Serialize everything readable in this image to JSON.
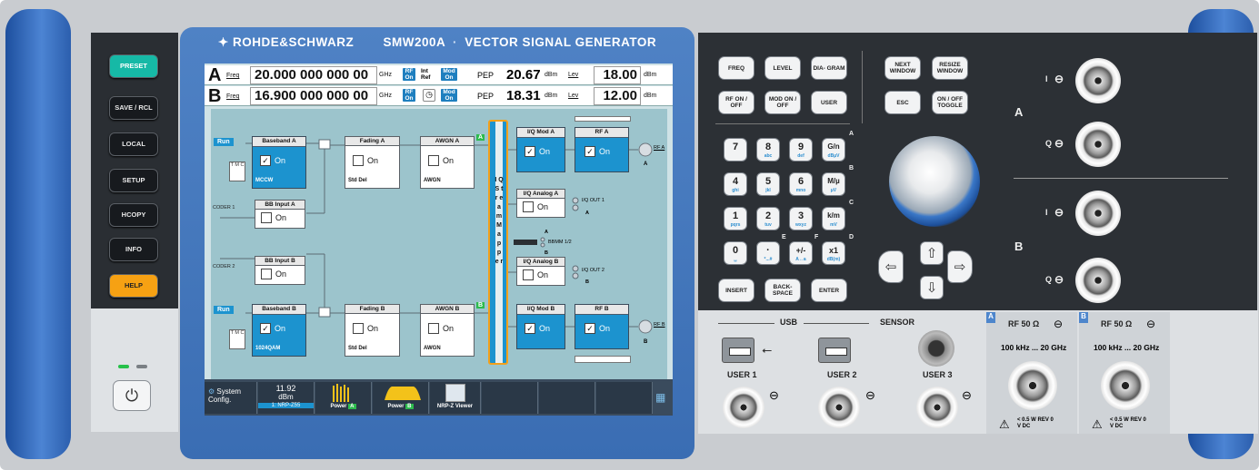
{
  "brand": {
    "logo": "ROHDE&SCHWARZ",
    "model": "SMW200A",
    "product": "VECTOR SIGNAL GENERATOR"
  },
  "colors": {
    "handle": "#2f63b0",
    "accent_blue": "#1c93cf",
    "preset": "#16b9a6",
    "help": "#f6a113",
    "mapper_border": "#f3a01a"
  },
  "hardkeys_left": [
    "PRESET",
    "SAVE / RCL",
    "LOCAL",
    "SETUP",
    "HCOPY",
    "INFO",
    "HELP"
  ],
  "power_icon": "power-icon",
  "status": {
    "a": {
      "letter": "A",
      "freq_label": "Freq",
      "freq_value": "20.000 000 000 00",
      "freq_unit": "GHz",
      "rf": "RF On",
      "int_ref": "Int Ref",
      "mod": "Mod On",
      "pep_label": "PEP",
      "pep_value": "20.67",
      "pep_unit": "dBm",
      "lev_label": "Lev",
      "lev_value": "18.00",
      "lev_unit": "dBm"
    },
    "b": {
      "letter": "B",
      "freq_label": "Freq",
      "freq_value": "16.900 000 000 00",
      "freq_unit": "GHz",
      "rf": "RF On",
      "mod": "Mod On",
      "pep_label": "PEP",
      "pep_value": "18.31",
      "pep_unit": "dBm",
      "lev_label": "Lev",
      "lev_value": "12.00",
      "lev_unit": "dBm"
    }
  },
  "diagram": {
    "run_label": "Run",
    "t_m_c": "T M C",
    "on": "On",
    "baseband_a": {
      "title": "Baseband A",
      "sub": "MCCW"
    },
    "baseband_b": {
      "title": "Baseband B",
      "sub": "1024QAM"
    },
    "coder1": "CODER 1",
    "coder2": "CODER 2",
    "bb_input_a": "BB Input A",
    "bb_input_b": "BB Input B",
    "fading_a": {
      "title": "Fading A",
      "sub": "Std Del"
    },
    "fading_b": {
      "title": "Fading B",
      "sub": "Std Del"
    },
    "awgn_a": {
      "title": "AWGN A",
      "sub": "AWGN"
    },
    "awgn_b": {
      "title": "AWGN B",
      "sub": "AWGN"
    },
    "badge_a": "A",
    "badge_b": "B",
    "mapper": "I Q S t r e a m M a p p e r",
    "iq_mod_a": "I/Q Mod A",
    "iq_mod_b": "I/Q Mod B",
    "rf_a": "RF A",
    "rf_b": "RF B",
    "rf_a_out": "RF A",
    "rf_b_out": "RF B",
    "iq_analog_a": "I/Q Analog A",
    "iq_analog_b": "I/Q Analog B",
    "iq_out_1": "I/Q OUT 1",
    "iq_out_2": "I/Q OUT 2",
    "bbmm": "BBMM 1/2",
    "letter_a": "A",
    "letter_b": "B"
  },
  "taskbar": {
    "system_config": "System Config.",
    "power_reading": "11.92",
    "power_unit": "dBm",
    "nrp_label": "1: NRP-Z55",
    "power_label": "Power",
    "tag_a": "A",
    "tag_b": "B",
    "nrp_viewer": "NRP-Z Viewer"
  },
  "keys_top": [
    "FREQ",
    "LEVEL",
    "DIA- GRAM",
    "RF ON / OFF",
    "MOD ON / OFF",
    "USER"
  ],
  "keys_nav": [
    "NEXT WINDOW",
    "RESIZE WINDOW",
    "ESC",
    "ON / OFF TOGGLE"
  ],
  "numpad": [
    {
      "main": "7",
      "sub": ""
    },
    {
      "main": "8",
      "sub": "abc"
    },
    {
      "main": "9",
      "sub": "def"
    },
    {
      "main": "G/n",
      "sub": "dBµV"
    },
    {
      "main": "4",
      "sub": "ghi"
    },
    {
      "main": "5",
      "sub": "jkl"
    },
    {
      "main": "6",
      "sub": "mno"
    },
    {
      "main": "M/µ",
      "sub": "µV"
    },
    {
      "main": "1",
      "sub": "pqrs"
    },
    {
      "main": "2",
      "sub": "tuv"
    },
    {
      "main": "3",
      "sub": "wxyz"
    },
    {
      "main": "k/m",
      "sub": "mV"
    },
    {
      "main": "0",
      "sub": "␣"
    },
    {
      "main": "·",
      "sub": "*...#"
    },
    {
      "main": "+/-",
      "sub": "A↔a"
    },
    {
      "main": "x1",
      "sub": "dB(m)"
    }
  ],
  "numpad_side_letters": [
    "A",
    "B",
    "C",
    "D",
    "E",
    "F"
  ],
  "keys_bottom": [
    "INSERT",
    "BACK- SPACE",
    "ENTER"
  ],
  "io": {
    "a_label": "A",
    "b_label": "B",
    "i": "I",
    "q": "Q"
  },
  "usb": {
    "label": "USB",
    "sensor": "SENSOR",
    "user1": "USER 1",
    "user2": "USER 2",
    "user3": "USER 3"
  },
  "rf_out": {
    "a": {
      "tab": "A",
      "title": "RF 50 Ω",
      "range": "100 kHz ... 20 GHz",
      "warn": "< 0.5 W REV 0 V DC"
    },
    "b": {
      "tab": "B",
      "title": "RF 50 Ω",
      "range": "100 kHz ... 20 GHz",
      "warn": "< 0.5 W REV 0 V DC"
    }
  }
}
